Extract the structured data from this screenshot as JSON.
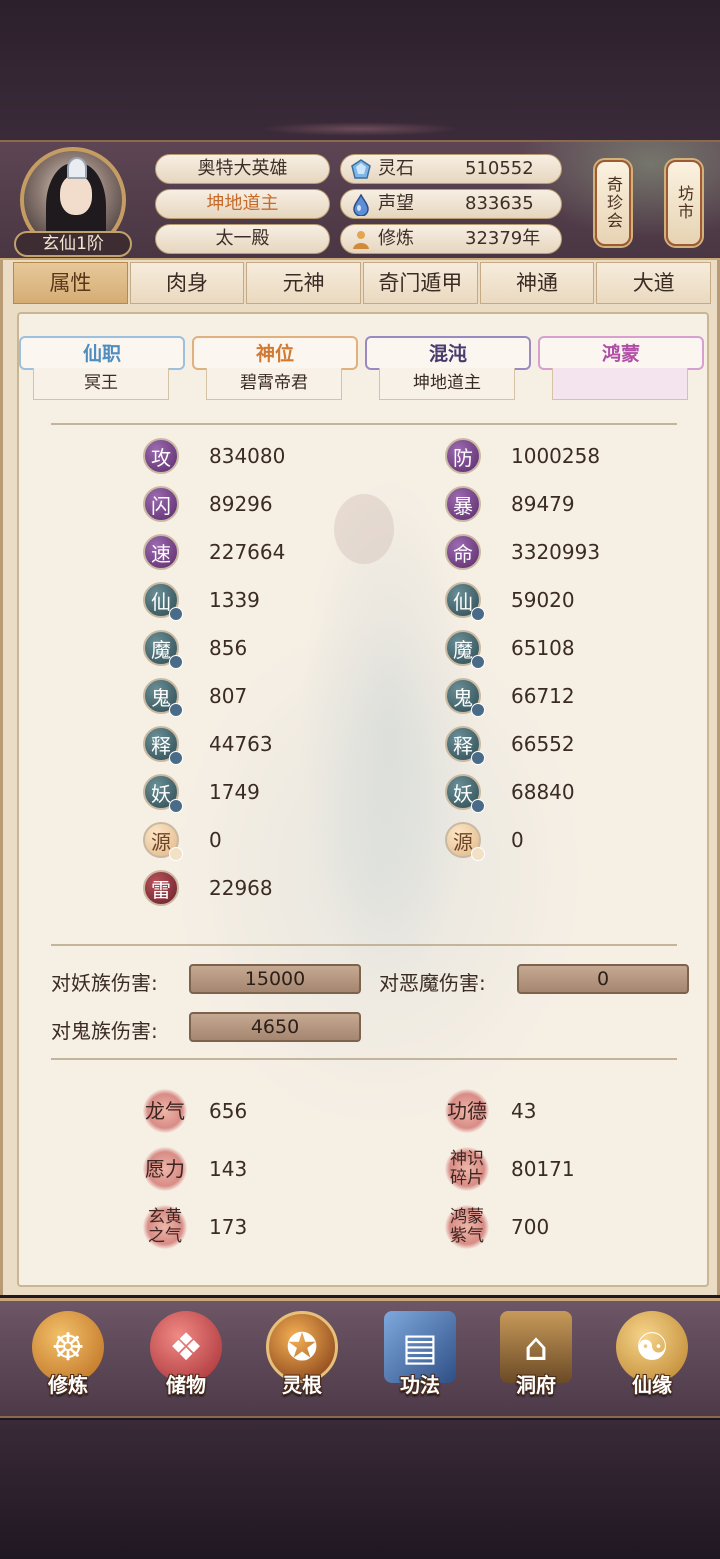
{
  "header": {
    "avatar_rank": "玄仙1阶",
    "name": "奥特大英雄",
    "title": "坤地道主",
    "palace": "太一殿",
    "resources": [
      {
        "icon": "spirit-stone-icon",
        "label": "灵石",
        "value": "510552"
      },
      {
        "icon": "fame-droplet-icon",
        "label": "声望",
        "value": "833635"
      },
      {
        "icon": "meditation-icon",
        "label": "修炼",
        "value": "32379年"
      }
    ],
    "side_buttons": [
      "奇珍会",
      "坊市"
    ]
  },
  "tabs": [
    "属性",
    "肉身",
    "元神",
    "奇门遁甲",
    "神通",
    "大道"
  ],
  "active_tab": "属性",
  "titles": [
    {
      "label": "仙职",
      "value": "冥王",
      "color": "#4f8dbf"
    },
    {
      "label": "神位",
      "value": "碧霄帝君",
      "color": "#d27a34"
    },
    {
      "label": "混沌",
      "value": "坤地道主",
      "color": "#5a4a86"
    },
    {
      "label": "鸿蒙",
      "value": "",
      "color": "#b04ea8"
    }
  ],
  "stats_left": [
    {
      "glyph": "攻",
      "value": "834080",
      "style": "p",
      "sub": ""
    },
    {
      "glyph": "闪",
      "value": "89296",
      "style": "p",
      "sub": ""
    },
    {
      "glyph": "速",
      "value": "227664",
      "style": "p",
      "sub": ""
    },
    {
      "glyph": "仙",
      "value": "1339",
      "style": "t",
      "sub": "!"
    },
    {
      "glyph": "魔",
      "value": "856",
      "style": "t",
      "sub": "!"
    },
    {
      "glyph": "鬼",
      "value": "807",
      "style": "t",
      "sub": "!"
    },
    {
      "glyph": "释",
      "value": "44763",
      "style": "t",
      "sub": "!"
    },
    {
      "glyph": "妖",
      "value": "1749",
      "style": "t",
      "sub": "!"
    },
    {
      "glyph": "源",
      "value": "0",
      "style": "o",
      "sub": "!"
    },
    {
      "glyph": "雷",
      "value": "22968",
      "style": "r",
      "sub": ""
    }
  ],
  "stats_right": [
    {
      "glyph": "防",
      "value": "1000258",
      "style": "p",
      "sub": ""
    },
    {
      "glyph": "暴",
      "value": "89479",
      "style": "p",
      "sub": ""
    },
    {
      "glyph": "命",
      "value": "3320993",
      "style": "p",
      "sub": ""
    },
    {
      "glyph": "仙",
      "value": "59020",
      "style": "t",
      "sub": "o"
    },
    {
      "glyph": "魔",
      "value": "65108",
      "style": "t",
      "sub": "o"
    },
    {
      "glyph": "鬼",
      "value": "66712",
      "style": "t",
      "sub": "o"
    },
    {
      "glyph": "释",
      "value": "66552",
      "style": "t",
      "sub": "o"
    },
    {
      "glyph": "妖",
      "value": "68840",
      "style": "t",
      "sub": "o"
    },
    {
      "glyph": "源",
      "value": "0",
      "style": "o",
      "sub": "o"
    }
  ],
  "damage": {
    "yao_label": "对妖族伤害:",
    "yao_value": "15000",
    "demon_label": "对恶魔伤害:",
    "demon_value": "0",
    "ghost_label": "对鬼族伤害:",
    "ghost_value": "4650"
  },
  "extras": [
    {
      "label": "龙气",
      "value": "656"
    },
    {
      "label": "功德",
      "value": "43"
    },
    {
      "label": "愿力",
      "value": "143"
    },
    {
      "label": "神识碎片",
      "value": "80171"
    },
    {
      "label": "玄黄之气",
      "value": "173"
    },
    {
      "label": "鸿蒙紫气",
      "value": "700"
    }
  ],
  "bottom_nav": [
    {
      "label": "修炼",
      "icon": "cultivate-monk-icon",
      "color": "#d58a2a"
    },
    {
      "label": "储物",
      "icon": "storage-bag-icon",
      "color": "#c2474a"
    },
    {
      "label": "灵根",
      "icon": "spirit-root-icon",
      "color": "#b9672c"
    },
    {
      "label": "功法",
      "icon": "scripture-book-icon",
      "color": "#4a74b0"
    },
    {
      "label": "洞府",
      "icon": "cave-house-icon",
      "color": "#8c6a3a"
    },
    {
      "label": "仙缘",
      "icon": "gourd-icon",
      "color": "#c69238"
    }
  ]
}
